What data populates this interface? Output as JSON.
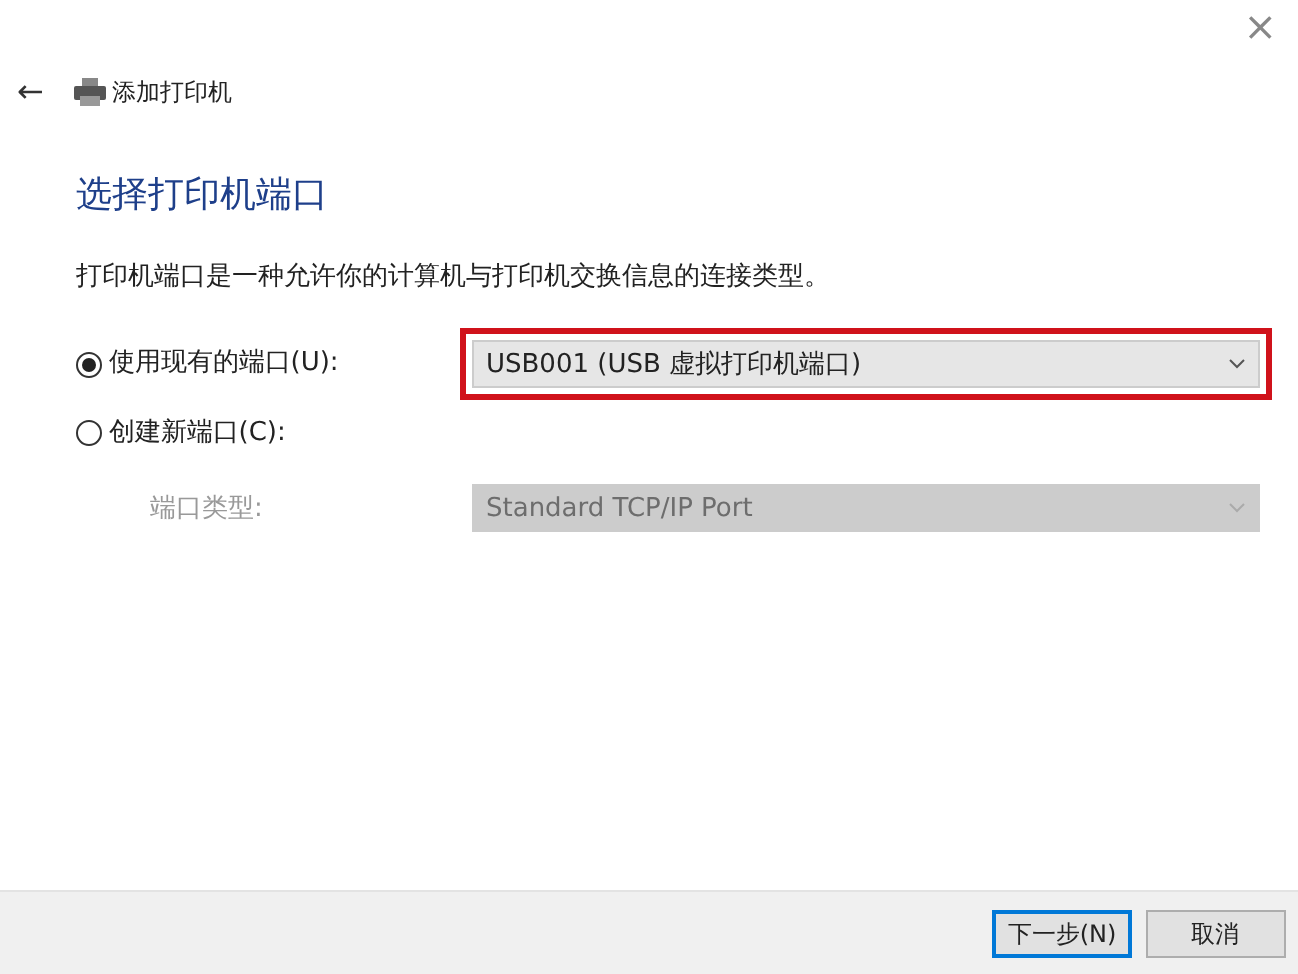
{
  "window": {
    "close": "×"
  },
  "header": {
    "back": "←",
    "title": "添加打印机"
  },
  "heading": "选择打印机端口",
  "description": "打印机端口是一种允许你的计算机与打印机交换信息的连接类型。",
  "options": [
    {
      "label": "使用现有的端口(U):",
      "selected": true,
      "dropdown": {
        "value": "USB001 (USB 虚拟打印机端口)",
        "disabled": false,
        "highlighted": true
      }
    },
    {
      "label": "创建新端口(C):",
      "selected": false
    }
  ],
  "port_type": {
    "label": "端口类型:",
    "value": "Standard TCP/IP Port",
    "disabled": true
  },
  "buttons": [
    {
      "label": "下一步(N)",
      "primary": true
    },
    {
      "label": "取消",
      "primary": false
    }
  ]
}
